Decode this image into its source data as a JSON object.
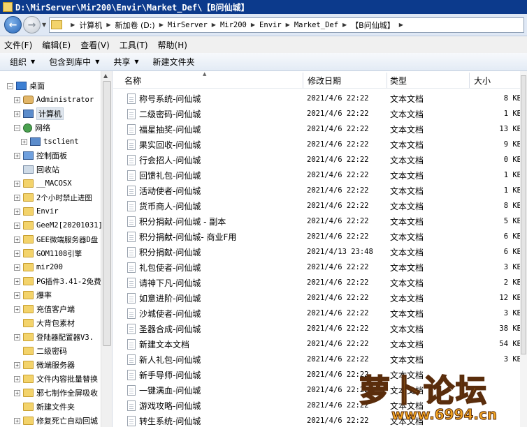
{
  "window": {
    "title": "D:\\MirServer\\Mir200\\Envir\\Market_Def\\【B问仙城】"
  },
  "address_bar": {
    "crumbs": [
      "计算机",
      "新加卷 (D:)",
      "MirServer",
      "Mir200",
      "Envir",
      "Market_Def",
      "【B问仙城】"
    ]
  },
  "menu": {
    "items": [
      "文件(F)",
      "编辑(E)",
      "查看(V)",
      "工具(T)",
      "帮助(H)"
    ]
  },
  "toolbar": {
    "organize": "组织",
    "include_in_library": "包含到库中",
    "share": "共享",
    "new_folder": "新建文件夹"
  },
  "nav_tree": [
    {
      "label": "桌面",
      "icon": "desktop-icon",
      "expander": "⊟"
    },
    {
      "label": "Administrator",
      "icon": "user-icon",
      "expander": "+"
    },
    {
      "label": "计算机",
      "icon": "computer-icon",
      "expander": "+",
      "selected": true
    },
    {
      "label": "网络",
      "icon": "network-icon",
      "expander": "−"
    },
    {
      "label": "tsclient",
      "icon": "client-icon",
      "expander": "+"
    },
    {
      "label": "控制面板",
      "icon": "control-panel-icon",
      "expander": "+"
    },
    {
      "label": "回收站",
      "icon": "recycle-bin-icon",
      "expander": ""
    },
    {
      "label": "__MACOSX",
      "icon": "folder-icon",
      "expander": "+"
    },
    {
      "label": "2个小时禁止进图",
      "icon": "folder-icon",
      "expander": "+"
    },
    {
      "label": "Envir",
      "icon": "folder-icon",
      "expander": "+"
    },
    {
      "label": "GeeM2[20201031]",
      "icon": "folder-icon",
      "expander": "+"
    },
    {
      "label": "GEE微端服务器D盘",
      "icon": "folder-icon",
      "expander": "+"
    },
    {
      "label": "GOM1108引擎",
      "icon": "folder-icon",
      "expander": "+"
    },
    {
      "label": "mir200",
      "icon": "folder-icon",
      "expander": "+"
    },
    {
      "label": "PG插件3.41-2免费",
      "icon": "folder-icon",
      "expander": "+"
    },
    {
      "label": "爆率",
      "icon": "folder-icon",
      "expander": "+"
    },
    {
      "label": "充值客户端",
      "icon": "folder-icon",
      "expander": "+"
    },
    {
      "label": "大背包素材",
      "icon": "folder-icon",
      "expander": ""
    },
    {
      "label": "登陆器配置器V3.",
      "icon": "folder-icon",
      "expander": "+"
    },
    {
      "label": "二级密码",
      "icon": "folder-icon",
      "expander": ""
    },
    {
      "label": "微端服务器",
      "icon": "folder-icon",
      "expander": "+"
    },
    {
      "label": "文件内容批量替换",
      "icon": "folder-icon",
      "expander": "+"
    },
    {
      "label": "邪七制作全屏吸收",
      "icon": "folder-icon",
      "expander": "+"
    },
    {
      "label": "新建文件夹",
      "icon": "folder-icon",
      "expander": ""
    },
    {
      "label": "修复死亡自动回城",
      "icon": "folder-icon",
      "expander": "+"
    }
  ],
  "columns": {
    "name": "名称",
    "date": "修改日期",
    "type": "类型",
    "size": "大小"
  },
  "files": [
    {
      "name": "称号系统-问仙城",
      "date": "2021/4/6 22:22",
      "type": "文本文档",
      "size": "8 KB"
    },
    {
      "name": "二级密码-问仙城",
      "date": "2021/4/6 22:22",
      "type": "文本文档",
      "size": "1 KB"
    },
    {
      "name": "福星抽奖-问仙城",
      "date": "2021/4/6 22:22",
      "type": "文本文档",
      "size": "13 KB"
    },
    {
      "name": "果实回收-问仙城",
      "date": "2021/4/6 22:22",
      "type": "文本文档",
      "size": "9 KB"
    },
    {
      "name": "行会招人-问仙城",
      "date": "2021/4/6 22:22",
      "type": "文本文档",
      "size": "0 KB"
    },
    {
      "name": "回馈礼包-问仙城",
      "date": "2021/4/6 22:22",
      "type": "文本文档",
      "size": "1 KB"
    },
    {
      "name": "活动使者-问仙城",
      "date": "2021/4/6 22:22",
      "type": "文本文档",
      "size": "1 KB"
    },
    {
      "name": "货币商人-问仙城",
      "date": "2021/4/6 22:22",
      "type": "文本文档",
      "size": "8 KB"
    },
    {
      "name": "积分捐献-问仙城 - 副本",
      "date": "2021/4/6 22:22",
      "type": "文本文档",
      "size": "5 KB"
    },
    {
      "name": "积分捐献-问仙城- 商业F用",
      "date": "2021/4/6 22:22",
      "type": "文本文档",
      "size": "6 KB"
    },
    {
      "name": "积分捐献-问仙城",
      "date": "2021/4/13 23:48",
      "type": "文本文档",
      "size": "6 KB"
    },
    {
      "name": "礼包使者-问仙城",
      "date": "2021/4/6 22:22",
      "type": "文本文档",
      "size": "3 KB"
    },
    {
      "name": "请神下凡-问仙城",
      "date": "2021/4/6 22:22",
      "type": "文本文档",
      "size": "2 KB"
    },
    {
      "name": "如意进阶-问仙城",
      "date": "2021/4/6 22:22",
      "type": "文本文档",
      "size": "12 KB"
    },
    {
      "name": "沙城使者-问仙城",
      "date": "2021/4/6 22:22",
      "type": "文本文档",
      "size": "3 KB"
    },
    {
      "name": "圣器合成-问仙城",
      "date": "2021/4/6 22:22",
      "type": "文本文档",
      "size": "38 KB"
    },
    {
      "name": "新建文本文档",
      "date": "2021/4/6 22:22",
      "type": "文本文档",
      "size": "54 KB"
    },
    {
      "name": "新人礼包-问仙城",
      "date": "2021/4/6 22:22",
      "type": "文本文档",
      "size": "3 KB"
    },
    {
      "name": "新手导师-问仙城",
      "date": "2021/4/6 22:22",
      "type": "文本文档",
      "size": ""
    },
    {
      "name": "一键满血-问仙城",
      "date": "2021/4/6 22:22",
      "type": "文本文档",
      "size": ""
    },
    {
      "name": "游戏攻略-问仙城",
      "date": "2021/4/6 22:22",
      "type": "文本文档",
      "size": ""
    },
    {
      "name": "转生系统-问仙城",
      "date": "2021/4/6 22:22",
      "type": "文本文档",
      "size": ""
    }
  ],
  "watermark": {
    "text": "萝卜论坛",
    "url": "www.6994.cn"
  }
}
